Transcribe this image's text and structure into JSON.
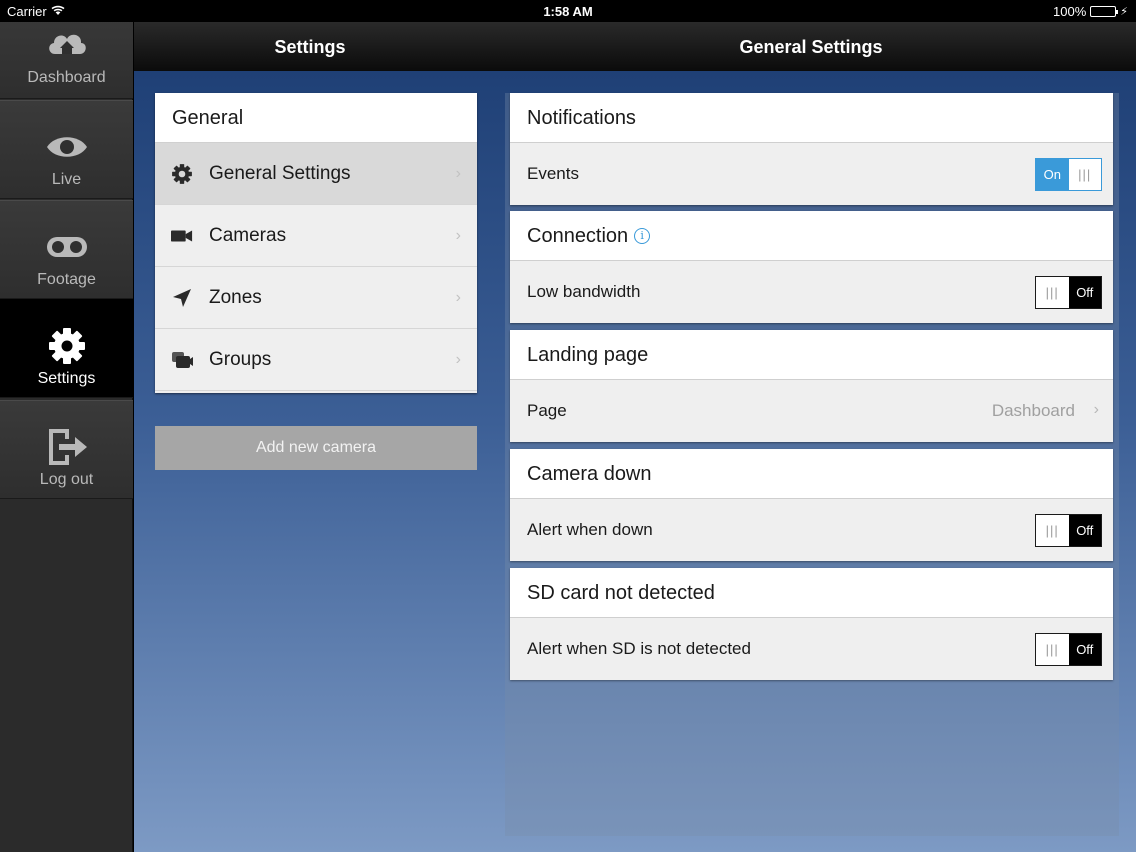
{
  "status_bar": {
    "carrier": "Carrier",
    "time": "1:58 AM",
    "battery": "100%"
  },
  "sidebar": {
    "items": [
      {
        "label": "Dashboard",
        "icon": "cloud-home-icon"
      },
      {
        "label": "Live",
        "icon": "eye-icon"
      },
      {
        "label": "Footage",
        "icon": "film-reel-icon"
      },
      {
        "label": "Settings",
        "icon": "gear-icon"
      },
      {
        "label": "Log out",
        "icon": "logout-icon"
      }
    ],
    "active": "Settings"
  },
  "navbar": {
    "left_title": "Settings",
    "right_title": "General Settings"
  },
  "menu": {
    "header": "General",
    "items": [
      {
        "label": "General Settings",
        "icon": "gear-icon"
      },
      {
        "label": "Cameras",
        "icon": "video-camera-icon"
      },
      {
        "label": "Zones",
        "icon": "location-arrow-icon"
      },
      {
        "label": "Groups",
        "icon": "camera-group-icon"
      }
    ],
    "selected": "General Settings"
  },
  "add_camera_label": "Add new camera",
  "sections": [
    {
      "title": "Notifications",
      "row_label": "Events",
      "toggle": "On"
    },
    {
      "title": "Connection",
      "row_label": "Low bandwidth",
      "toggle": "Off",
      "info_icon": "info-icon"
    },
    {
      "title": "Landing page",
      "row_label": "Page",
      "value": "Dashboard"
    },
    {
      "title": "Camera down",
      "row_label": "Alert when down",
      "toggle": "Off"
    },
    {
      "title": "SD card not detected",
      "row_label": "Alert when SD is not detected",
      "toggle": "Off"
    }
  ],
  "toggle_grip": "|||",
  "colors": {
    "accent": "#3a9ad9",
    "sidebar_bg": "#2b2b2b",
    "active_bg": "#000000"
  }
}
